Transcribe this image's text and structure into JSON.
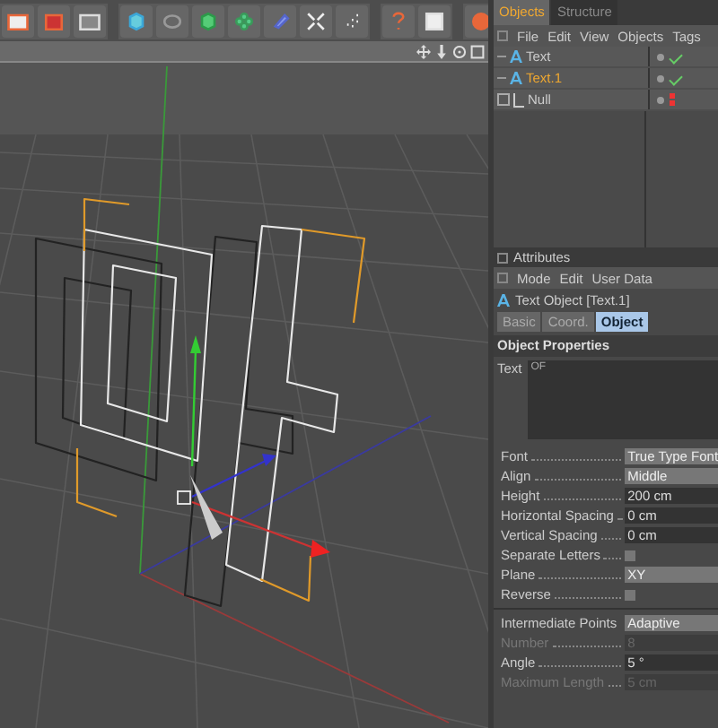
{
  "object_manager": {
    "tabs": [
      {
        "label": "Objects",
        "selected": true
      },
      {
        "label": "Structure",
        "selected": false
      }
    ],
    "menu": [
      "File",
      "Edit",
      "View",
      "Objects",
      "Tags"
    ],
    "items": [
      {
        "name": "Text",
        "kind": "text",
        "selected": false,
        "enabled": true
      },
      {
        "name": "Text.1",
        "kind": "text",
        "selected": true,
        "enabled": true
      },
      {
        "name": "Null",
        "kind": "null",
        "selected": false,
        "enabled": false
      }
    ]
  },
  "attributes": {
    "title": "Attributes",
    "menu": [
      "Mode",
      "Edit",
      "User Data"
    ],
    "object_title": "Text Object [Text.1]",
    "tabs": [
      {
        "label": "Basic",
        "selected": false
      },
      {
        "label": "Coord.",
        "selected": false
      },
      {
        "label": "Object",
        "selected": true
      }
    ],
    "section": "Object Properties",
    "text_field": {
      "label": "Text",
      "value": "OF"
    },
    "params": [
      {
        "kind": "dropdown",
        "label": "Font",
        "value": "True Type Font",
        "disabled": false
      },
      {
        "kind": "dropdown",
        "label": "Align",
        "value": "Middle",
        "disabled": false
      },
      {
        "kind": "spinner",
        "label": "Height",
        "value": "200 cm",
        "disabled": false
      },
      {
        "kind": "spinner",
        "label": "Horizontal Spacing",
        "value": "0 cm",
        "disabled": false
      },
      {
        "kind": "spinner",
        "label": "Vertical Spacing",
        "value": "0 cm",
        "disabled": false
      },
      {
        "kind": "checkbox",
        "label": "Separate Letters",
        "checked": false,
        "disabled": false
      },
      {
        "kind": "dropdown",
        "label": "Plane",
        "value": "XY",
        "disabled": false
      },
      {
        "kind": "checkbox",
        "label": "Reverse",
        "checked": false,
        "disabled": false
      },
      {
        "kind": "separator"
      },
      {
        "kind": "dropdown",
        "label": "Intermediate Points",
        "value": "Adaptive",
        "disabled": false
      },
      {
        "kind": "spinner",
        "label": "Number",
        "value": "8",
        "disabled": true
      },
      {
        "kind": "spinner",
        "label": "Angle",
        "value": "5 °",
        "disabled": false
      },
      {
        "kind": "spinner",
        "label": "Maximum Length",
        "value": "5 cm",
        "disabled": true
      }
    ]
  }
}
